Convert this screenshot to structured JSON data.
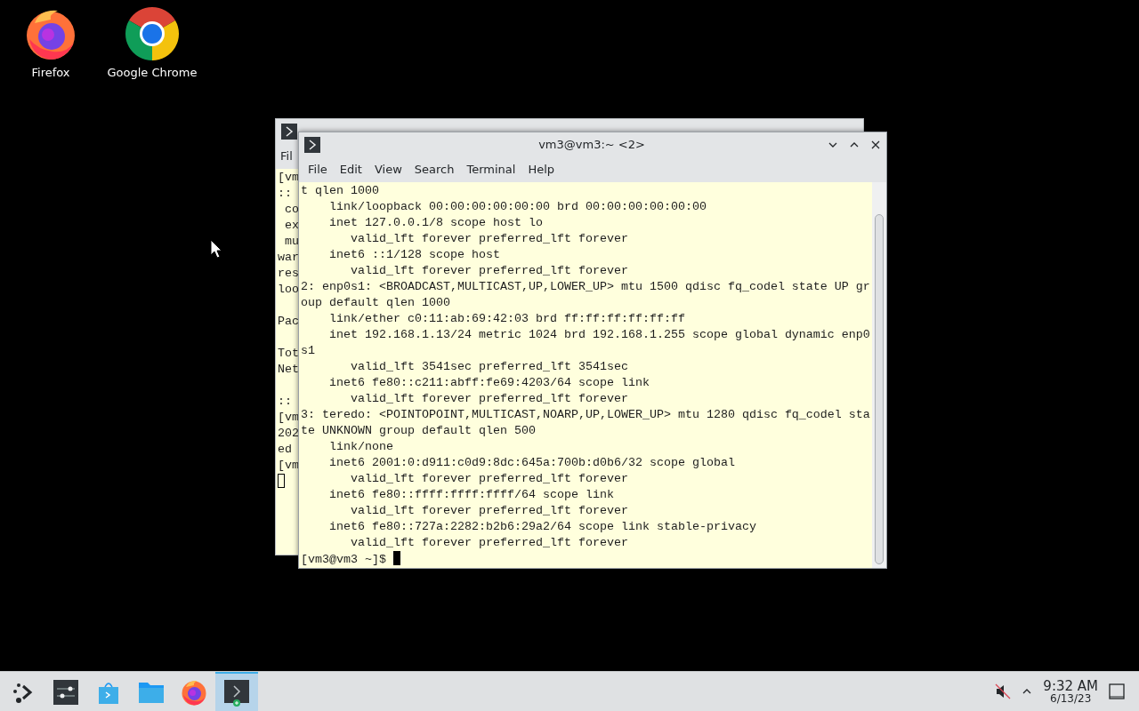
{
  "desktop_icons": [
    {
      "label": "Firefox",
      "kind": "firefox"
    },
    {
      "label": "Google Chrome",
      "kind": "chrome"
    }
  ],
  "back_terminal": {
    "focused": false,
    "menu": [
      "Fil"
    ],
    "lines": [
      {
        "text": "[vm"
      },
      {
        "text": "::"
      },
      {
        "text": " co"
      },
      {
        "text": " ex"
      },
      {
        "text": " mu"
      },
      {
        "text": "war"
      },
      {
        "text": "res"
      },
      {
        "text": "loo"
      },
      {
        "text": "Pac",
        "blank_before": true
      },
      {
        "text": "Tot",
        "blank_before": true
      },
      {
        "text": "Net"
      },
      {
        "text": "::",
        "blank_before": true
      },
      {
        "text": "[vm"
      },
      {
        "text": "202"
      },
      {
        "text": "ed"
      },
      {
        "text": "[vm"
      }
    ]
  },
  "front_terminal": {
    "title": "vm3@vm3:~ <2>",
    "focused": true,
    "menu": [
      "File",
      "Edit",
      "View",
      "Search",
      "Terminal",
      "Help"
    ],
    "lines": [
      "t qlen 1000",
      "    link/loopback 00:00:00:00:00:00 brd 00:00:00:00:00:00",
      "    inet 127.0.0.1/8 scope host lo",
      "       valid_lft forever preferred_lft forever",
      "    inet6 ::1/128 scope host",
      "       valid_lft forever preferred_lft forever",
      "2: enp0s1: <BROADCAST,MULTICAST,UP,LOWER_UP> mtu 1500 qdisc fq_codel state UP gr",
      "oup default qlen 1000",
      "    link/ether c0:11:ab:69:42:03 brd ff:ff:ff:ff:ff:ff",
      "    inet 192.168.1.13/24 metric 1024 brd 192.168.1.255 scope global dynamic enp0",
      "s1",
      "       valid_lft 3541sec preferred_lft 3541sec",
      "    inet6 fe80::c211:abff:fe69:4203/64 scope link",
      "       valid_lft forever preferred_lft forever",
      "3: teredo: <POINTOPOINT,MULTICAST,NOARP,UP,LOWER_UP> mtu 1280 qdisc fq_codel sta",
      "te UNKNOWN group default qlen 500",
      "    link/none",
      "    inet6 2001:0:d911:c0d9:8dc:645a:700b:d0b6/32 scope global",
      "       valid_lft forever preferred_lft forever",
      "    inet6 fe80::ffff:ffff:ffff/64 scope link",
      "       valid_lft forever preferred_lft forever",
      "    inet6 fe80::727a:2282:b2b6:29a2/64 scope link stable-privacy",
      "       valid_lft forever preferred_lft forever"
    ],
    "prompt": "[vm3@vm3 ~]$ "
  },
  "taskbar": {
    "items": [
      {
        "kind": "launcher",
        "selected": false
      },
      {
        "kind": "settings",
        "selected": false
      },
      {
        "kind": "discover",
        "selected": false
      },
      {
        "kind": "files",
        "selected": false
      },
      {
        "kind": "firefox",
        "selected": false
      },
      {
        "kind": "terminal",
        "selected": true
      }
    ],
    "volume_muted": true,
    "time": "9:32 AM",
    "date": "6/13/23"
  }
}
